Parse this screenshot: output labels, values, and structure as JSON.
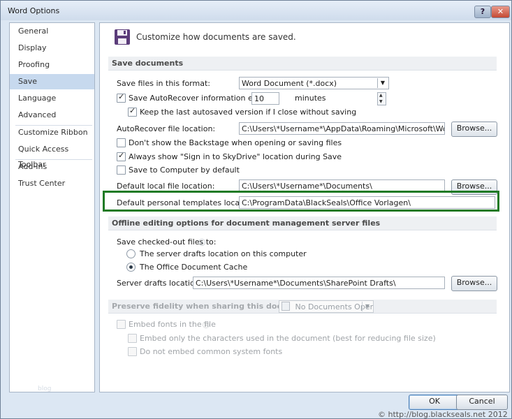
{
  "window": {
    "title": "Word Options",
    "help_label": "?",
    "close_label": "✕"
  },
  "sidebar": {
    "items": [
      {
        "label": "General"
      },
      {
        "label": "Display"
      },
      {
        "label": "Proofing"
      },
      {
        "label": "Save",
        "active": true
      },
      {
        "label": "Language"
      },
      {
        "label": "Advanced"
      },
      {
        "label": "Customize Ribbon"
      },
      {
        "label": "Quick Access Toolbar"
      },
      {
        "label": "Add-Ins"
      },
      {
        "label": "Trust Center"
      }
    ],
    "watermark": "blog"
  },
  "main": {
    "header": "Customize how documents are saved.",
    "header_icon": "floppy-disk-icon",
    "save_documents": {
      "title": "Save documents",
      "format_label": "Save files in this format:",
      "format_value": "Word Document (*.docx)",
      "autorecover_label": "Save AutoRecover information every",
      "autorecover_checked": true,
      "autorecover_minutes": "10",
      "minutes_label": "minutes",
      "keep_last_label": "Keep the last autosaved version if I close without saving",
      "keep_last_checked": true,
      "autorecover_location_label": "AutoRecover file location:",
      "autorecover_location_value": "C:\\Users\\*Username*\\AppData\\Roaming\\Microsoft\\Word\\",
      "browse_label": "Browse...",
      "backstage_label": "Don't show the Backstage when opening or saving files",
      "backstage_checked": false,
      "skydrive_label": "Always show \"Sign in to SkyDrive\" location during Save",
      "skydrive_checked": true,
      "save_computer_label": "Save to Computer by default",
      "save_computer_checked": false,
      "default_local_label": "Default local file location:",
      "default_local_value": "C:\\Users\\*Username*\\Documents\\",
      "templates_label": "Default personal templates location:",
      "templates_value": "C:\\ProgramData\\BlackSeals\\Office Vorlagen\\"
    },
    "offline": {
      "title": "Offline editing options for document management server files",
      "checked_out_label": "Save checked-out files to:",
      "server_drafts_option": "The server drafts location on this computer",
      "office_cache_option": "The Office Document Cache",
      "selected_option": "office-cache",
      "server_drafts_label": "Server drafts location:",
      "server_drafts_value": "C:\\Users\\*Username*\\Documents\\SharePoint Drafts\\",
      "browse_label": "Browse..."
    },
    "fidelity": {
      "title": "Preserve fidelity when sharing this document:",
      "document_value": "No Documents Open",
      "embed_fonts_label": "Embed fonts in the file",
      "embed_chars_label": "Embed only the characters used in the document (best for reducing file size)",
      "no_common_label": "Do not embed common system fonts"
    }
  },
  "footer": {
    "ok_label": "OK",
    "cancel_label": "Cancel",
    "copyright": "© http://blog.blackseals.net 2012"
  },
  "colors": {
    "highlight_border": "#1f7a25",
    "selected_nav": "#c7d9ee"
  }
}
